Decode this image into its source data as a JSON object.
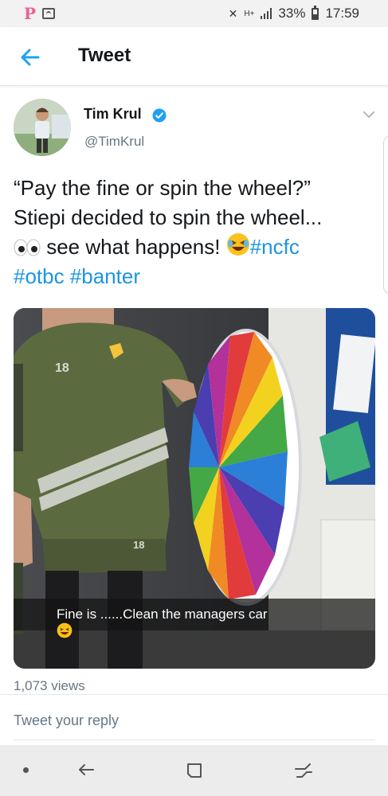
{
  "status_bar": {
    "app_icon": "P",
    "battery_percent": "33%",
    "time": "17:59",
    "network": "H+",
    "icons": [
      "pinterest-icon",
      "screenshot-icon",
      "mute-icon",
      "signal-icon",
      "battery-icon"
    ]
  },
  "header": {
    "title": "Tweet",
    "back_icon": "arrow-left-icon"
  },
  "tweet": {
    "author_name": "Tim Krul",
    "author_handle": "@TimKrul",
    "verified": true,
    "text_line1": "“Pay the fine or spin the wheel?”",
    "text_line2": "Stiepi decided to spin the wheel...",
    "text_line3_plain": " see what happens! ",
    "hashtags": [
      "#ncfc",
      "#otbc",
      "#banter"
    ],
    "emojis": [
      "eyes-emoji",
      "laughing-emoji"
    ]
  },
  "media": {
    "caption": "Fine is ......Clean the managers car",
    "shirt_number": "18"
  },
  "views": "1,073 views",
  "reply": {
    "placeholder": "Tweet your reply"
  },
  "colors": {
    "accent": "#1da1f2",
    "hashtag": "#1b95e0",
    "text": "#14171a",
    "secondary": "#657786"
  }
}
